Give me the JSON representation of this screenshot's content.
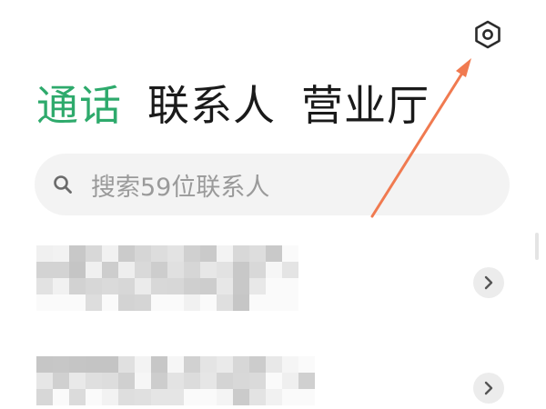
{
  "header": {
    "settings_icon": "settings-hexagon-icon"
  },
  "tabs": [
    {
      "label": "通话",
      "active": true
    },
    {
      "label": "联系人",
      "active": false
    },
    {
      "label": "营业厅",
      "active": false
    }
  ],
  "search": {
    "placeholder": "搜索59位联系人",
    "icon": "search-icon"
  },
  "contacts": [
    {
      "name_redacted": true,
      "icon": "chevron-right-icon"
    },
    {
      "name_redacted": true,
      "icon": "chevron-right-icon"
    }
  ],
  "annotation": {
    "type": "arrow",
    "color": "#f07a50"
  },
  "colors": {
    "accent": "#2eaa6c",
    "text": "#1a1a1a",
    "placeholder": "#9a9a9a",
    "search_bg": "#f3f3f3"
  }
}
